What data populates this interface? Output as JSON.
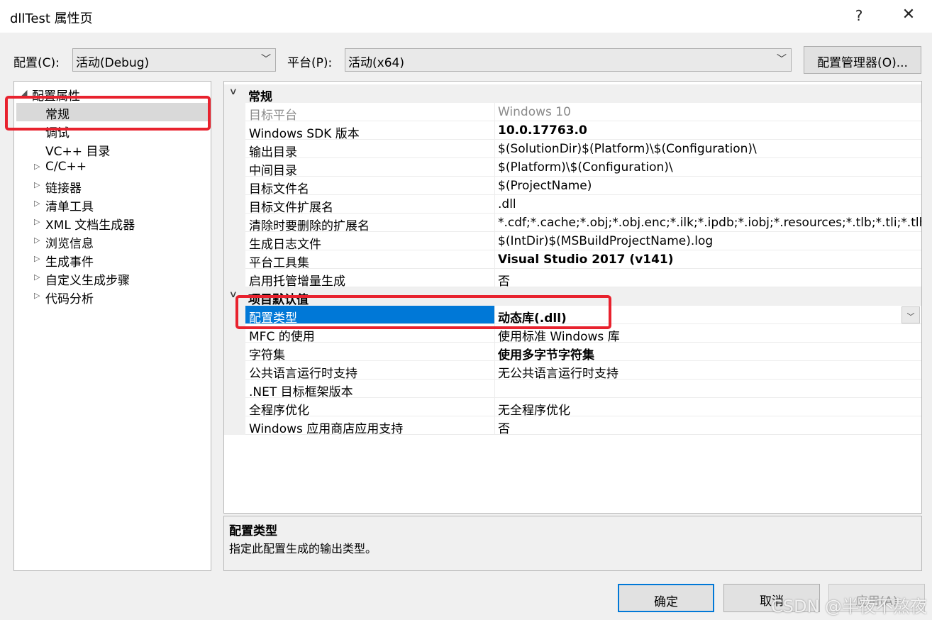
{
  "window": {
    "title": "dllTest 属性页",
    "help": "?",
    "close": "✕"
  },
  "config_bar": {
    "config_label": "配置(C):",
    "config_value": "活动(Debug)",
    "platform_label": "平台(P):",
    "platform_value": "活动(x64)",
    "manager_button": "配置管理器(O)..."
  },
  "tree": {
    "root": "配置属性",
    "items": [
      {
        "label": "常规",
        "selected": true,
        "expandable": false
      },
      {
        "label": "调试",
        "expandable": false
      },
      {
        "label": "VC++ 目录",
        "expandable": false
      },
      {
        "label": "C/C++",
        "expandable": true
      },
      {
        "label": "链接器",
        "expandable": true
      },
      {
        "label": "清单工具",
        "expandable": true
      },
      {
        "label": "XML 文档生成器",
        "expandable": true
      },
      {
        "label": "浏览信息",
        "expandable": true
      },
      {
        "label": "生成事件",
        "expandable": true
      },
      {
        "label": "自定义生成步骤",
        "expandable": true
      },
      {
        "label": "代码分析",
        "expandable": true
      }
    ]
  },
  "grid": {
    "sections": [
      {
        "title": "常规",
        "rows": [
          {
            "name": "目标平台",
            "value": "Windows 10",
            "dim": true
          },
          {
            "name": "Windows SDK 版本",
            "value": "10.0.17763.0",
            "bold": true
          },
          {
            "name": "输出目录",
            "value": "$(SolutionDir)$(Platform)\\$(Configuration)\\"
          },
          {
            "name": "中间目录",
            "value": "$(Platform)\\$(Configuration)\\"
          },
          {
            "name": "目标文件名",
            "value": "$(ProjectName)"
          },
          {
            "name": "目标文件扩展名",
            "value": ".dll"
          },
          {
            "name": "清除时要删除的扩展名",
            "value": "*.cdf;*.cache;*.obj;*.obj.enc;*.ilk;*.ipdb;*.iobj;*.resources;*.tlb;*.tli;*.tlh;*.t"
          },
          {
            "name": "生成日志文件",
            "value": "$(IntDir)$(MSBuildProjectName).log"
          },
          {
            "name": "平台工具集",
            "value": "Visual Studio 2017 (v141)",
            "bold": true
          },
          {
            "name": "启用托管增量生成",
            "value": "否"
          }
        ]
      },
      {
        "title": "项目默认值",
        "rows": [
          {
            "name": "配置类型",
            "value": "动态库(.dll)",
            "bold": true,
            "selected": true
          },
          {
            "name": "MFC 的使用",
            "value": "使用标准 Windows 库"
          },
          {
            "name": "字符集",
            "value": "使用多字节字符集",
            "bold": true
          },
          {
            "name": "公共语言运行时支持",
            "value": "无公共语言运行时支持"
          },
          {
            "name": ".NET 目标框架版本",
            "value": ""
          },
          {
            "name": "全程序优化",
            "value": "无全程序优化"
          },
          {
            "name": "Windows 应用商店应用支持",
            "value": "否"
          }
        ]
      }
    ]
  },
  "description": {
    "title": "配置类型",
    "text": "指定此配置生成的输出类型。"
  },
  "buttons": {
    "ok": "确定",
    "cancel": "取消",
    "apply": "应用(A)"
  },
  "watermark": "CSDN @半夜不熬夜",
  "colors": {
    "selection": "#0078d7",
    "highlight_box": "#e8222e",
    "tree_selection": "#d9d9d9"
  }
}
